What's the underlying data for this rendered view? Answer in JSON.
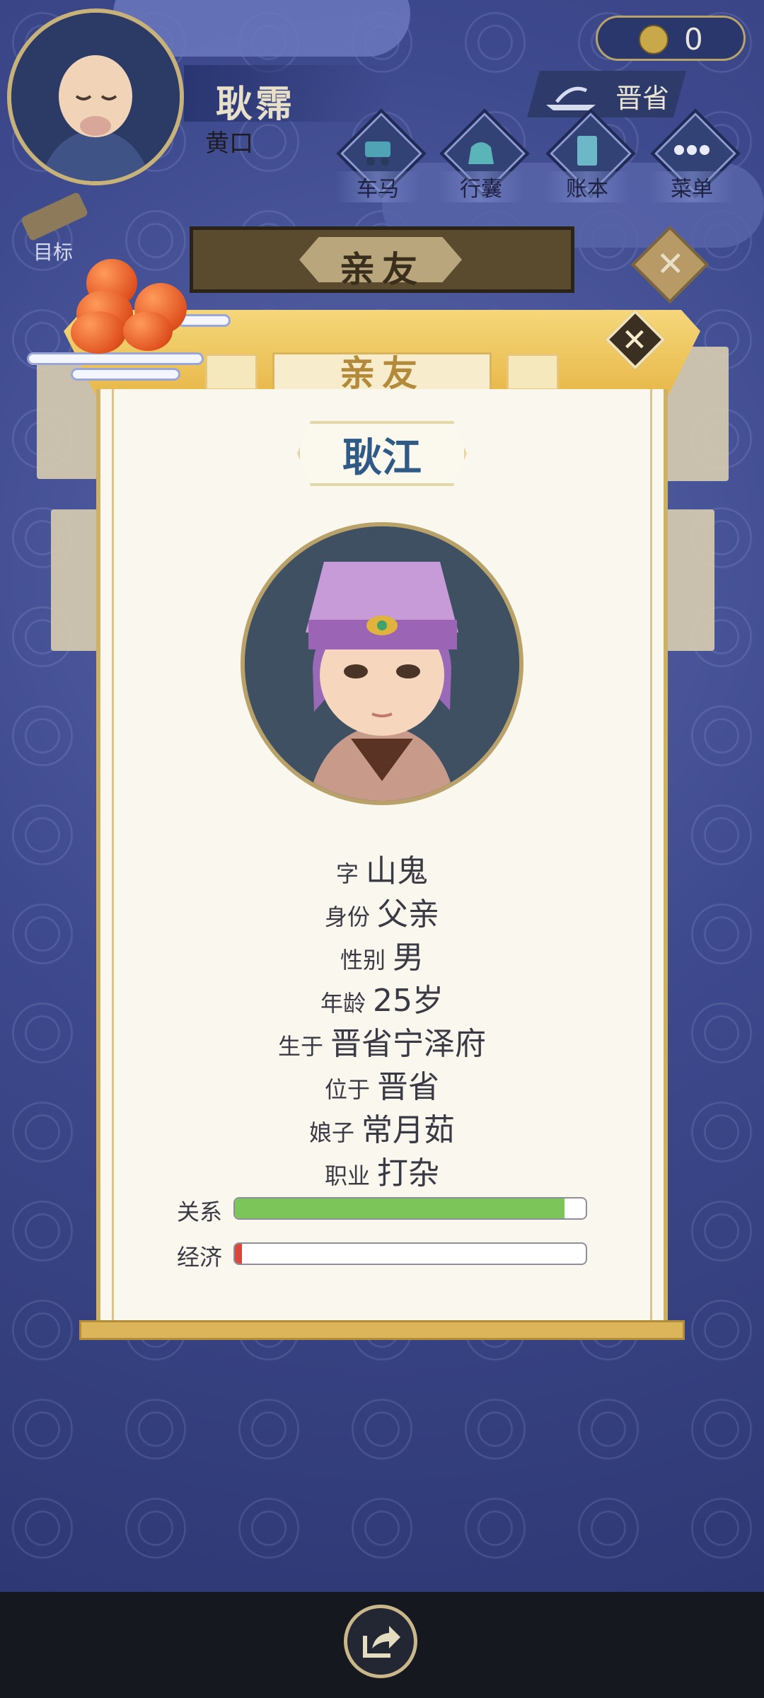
{
  "player": {
    "name": "耿霈",
    "title": "黄口"
  },
  "coins": {
    "value": "0"
  },
  "region": {
    "label": "晋省"
  },
  "nav": [
    {
      "label": "车马",
      "icon": "carriage-icon"
    },
    {
      "label": "行囊",
      "icon": "bag-icon"
    },
    {
      "label": "账本",
      "icon": "ledger-icon"
    },
    {
      "label": "菜单",
      "icon": "more-icon"
    }
  ],
  "goal": {
    "label": "目标"
  },
  "banner": {
    "title": "亲友",
    "close": "✕"
  },
  "dialog": {
    "title": "亲友",
    "close": "✕",
    "relative_name": "耿江",
    "fields": [
      {
        "key": "字",
        "value": "山鬼"
      },
      {
        "key": "身份",
        "value": "父亲"
      },
      {
        "key": "性别",
        "value": "男"
      },
      {
        "key": "年龄",
        "value": "25岁"
      },
      {
        "key": "生于",
        "value": "晋省宁泽府"
      },
      {
        "key": "位于",
        "value": "晋省"
      },
      {
        "key": "娘子",
        "value": "常月茹"
      },
      {
        "key": "职业",
        "value": "打杂"
      }
    ],
    "bars": [
      {
        "label": "关系",
        "level": 0.94,
        "color": "#7cc559"
      },
      {
        "label": "经济",
        "level": 0.02,
        "color": "#d9473c"
      }
    ]
  },
  "colors": {
    "accent_gold": "#cdb06a",
    "name_blue": "#2f5a86"
  }
}
